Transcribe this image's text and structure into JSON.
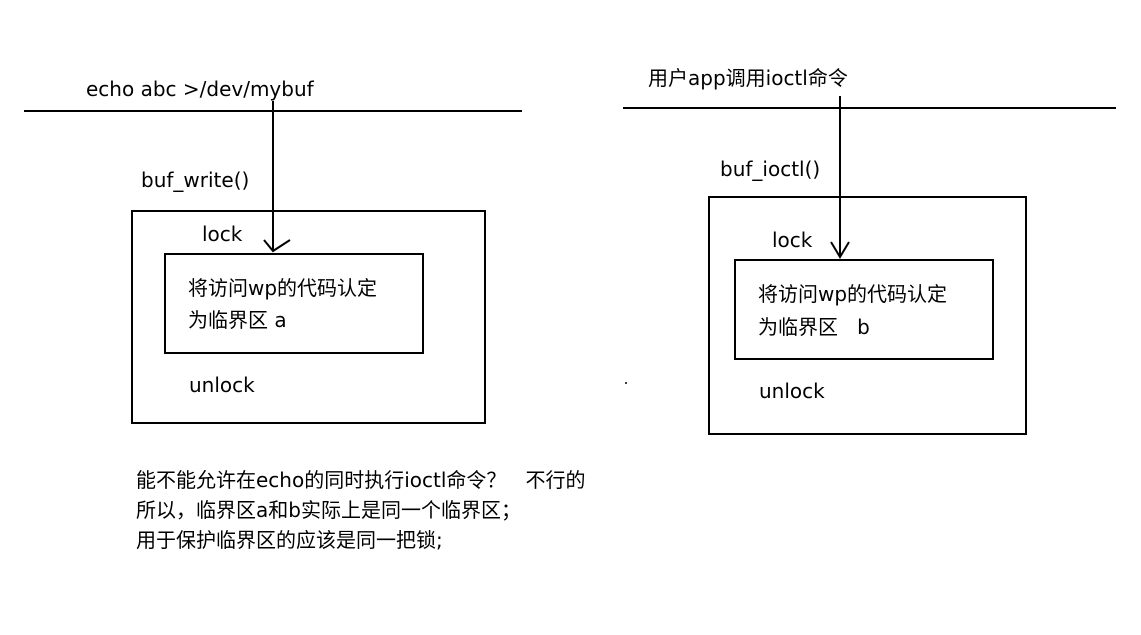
{
  "left": {
    "command": "echo abc >/dev/mybuf",
    "function": "buf_write()",
    "lock": "lock",
    "critical_line1": "将访问wp的代码认定",
    "critical_line2": "为临界区 a",
    "unlock": "unlock"
  },
  "right": {
    "command": "用户app调用ioctl命令",
    "function": "buf_ioctl()",
    "lock": "lock",
    "critical_line1": "将访问wp的代码认定",
    "critical_line2": "为临界区   b",
    "unlock": "unlock"
  },
  "notes": [
    "能不能允许在echo的同时执行ioctl命令？   不行的",
    "所以，临界区a和b实际上是同一个临界区；",
    "用于保护临界区的应该是同一把锁;"
  ]
}
